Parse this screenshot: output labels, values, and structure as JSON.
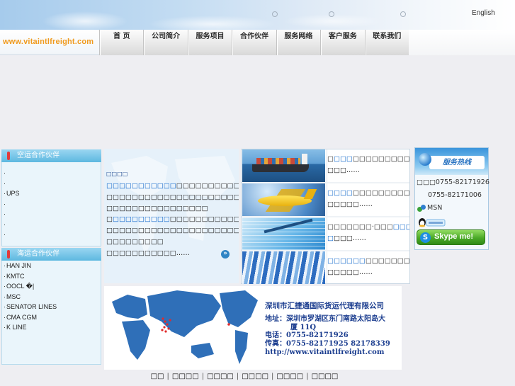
{
  "header": {
    "language_link": "English"
  },
  "logo": {
    "text": "www.vitaintlfreight.com"
  },
  "nav": {
    "items": [
      "首 页",
      "公司简介",
      "服务项目",
      "合作伙伴",
      "服务网络",
      "客户服务",
      "联系我们"
    ]
  },
  "sidebar": {
    "air": {
      "title": "空运合作伙伴",
      "items": [
        "",
        "",
        "UPS",
        "",
        "",
        "",
        ""
      ]
    },
    "sea": {
      "title": "海运合作伙伴",
      "items": [
        "HAN JIN",
        "KMTC",
        "OOCL �|",
        "MSC",
        "SENATOR LINES",
        "CMA CGM",
        "K LINE"
      ]
    }
  },
  "intro": {
    "lines": [
      [
        {
          "t": "□□□□",
          "hl": false
        }
      ],
      [
        {
          "t": "□□□□□□□□□□□",
          "hl": true
        },
        {
          "t": "□□□□□□□□□□□□□□",
          "hl": false
        }
      ],
      [
        {
          "t": "□□□□□□□□□□□□□□□□□□□□□□□□□",
          "hl": false
        }
      ],
      [
        {
          "t": "□□□□□□□□□□□□□□□□",
          "hl": false
        }
      ],
      [
        {
          "t": "□",
          "hl": false
        },
        {
          "t": "□□□□□□□□□",
          "hl": true
        },
        {
          "t": "□□□□□□□□□□□□□□□",
          "hl": false
        }
      ],
      [
        {
          "t": "□□□□□□□□□□□□□□□□□□□□□□□□□",
          "hl": false
        }
      ],
      [
        {
          "t": "□□□□□□□□□",
          "hl": false
        }
      ],
      [
        {
          "t": "□□□□□□□□□□□……",
          "hl": false
        }
      ]
    ],
    "more_symbol": "»"
  },
  "services": [
    {
      "image": "cargo-ship",
      "lines": [
        [
          {
            "t": "□",
            "hl": false
          },
          {
            "t": "□□□",
            "hl": true
          },
          {
            "t": "□□□□□□□□□□□□",
            "hl": false
          }
        ],
        [
          {
            "t": "□□□……",
            "hl": false
          }
        ]
      ]
    },
    {
      "image": "airplane",
      "lines": [
        [
          {
            "t": "□□□□",
            "hl": true
          },
          {
            "t": "□□□□□□□□□□□□",
            "hl": false
          }
        ],
        [
          {
            "t": "□□□□□……",
            "hl": false
          }
        ]
      ]
    },
    {
      "image": "documents",
      "lines": [
        [
          {
            "t": "□□□□□□□·□□□",
            "hl": false
          },
          {
            "t": "□□□",
            "hl": true
          }
        ],
        [
          {
            "t": "□",
            "hl": true
          },
          {
            "t": "□□□……",
            "hl": false
          }
        ]
      ]
    },
    {
      "image": "folders",
      "lines": [
        [
          {
            "t": "□□□□□□",
            "hl": true
          },
          {
            "t": "□□□□□□□□□□",
            "hl": false
          }
        ],
        [
          {
            "t": "□□□□□……",
            "hl": false
          }
        ]
      ]
    }
  ],
  "hotline": {
    "title": "服务热线",
    "phone1": "□□□0755-82171926",
    "phone2": "0755-82171006",
    "msn": "MSN",
    "skype": "Skype me!",
    "skype_icon_letter": "S"
  },
  "company_card": {
    "name": "深圳市汇捷通国际货运代理有限公司",
    "address_line1": "地址：深圳市罗湖区东门南路太阳岛大",
    "address_line2": "厦 11Q",
    "tel": "电话：0755-82171926",
    "fax": "传真：0755-82171925  82178339",
    "url": "http://www.vitaintlfreight.com"
  },
  "footer": {
    "links": [
      "□□",
      "□□□□",
      "□□□□",
      "□□□□",
      "□□□□",
      "□□□□"
    ],
    "separator": "|"
  },
  "colors": {
    "link_blue": "#0a63c9",
    "logo_orange": "#f09a1d",
    "sidebar_header": "#5db8e0",
    "marker_red": "#e23b3b",
    "skype_green": "#48a829",
    "card_navy": "#1b3d8f"
  }
}
